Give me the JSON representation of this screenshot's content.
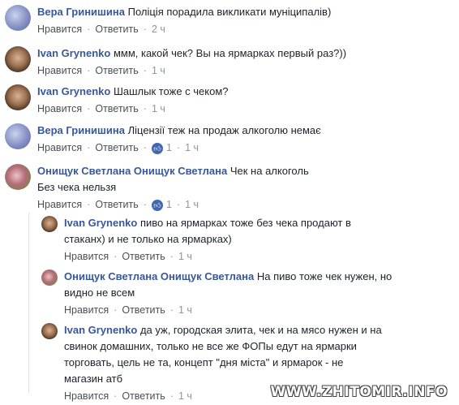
{
  "comments": [
    {
      "author": "Вера Гринишина",
      "text": "Поліція порадила викликати муніципалів)",
      "like_label": "Нравится",
      "reply_label": "Ответить",
      "time": "2 ч",
      "likes": ""
    },
    {
      "author": "Ivan Grynenko",
      "text": "ммм, какой чек? Вы на ярмарках первый раз?))",
      "like_label": "Нравится",
      "reply_label": "Ответить",
      "time": "1 ч",
      "likes": ""
    },
    {
      "author": "Ivan Grynenko",
      "text": "Шашлык тоже с чеком?",
      "like_label": "Нравится",
      "reply_label": "Ответить",
      "time": "1 ч",
      "likes": ""
    },
    {
      "author": "Вера Гринишина",
      "text": "Ліцензії теж на продаж алкоголю немає",
      "like_label": "Нравится",
      "reply_label": "Ответить",
      "time": "1 ч",
      "likes": "1"
    },
    {
      "author": "Онищук Светлана Онищук Светлана",
      "text": "Чек на алкоголь",
      "text2": "Без чека нельзя",
      "like_label": "Нравится",
      "reply_label": "Ответить",
      "time": "1 ч",
      "likes": "1"
    }
  ],
  "replies": [
    {
      "author": "Ivan Grynenko",
      "text_line1": "пиво на ярмарках тоже без чека продают в",
      "text_line2": "стаканх) и не только на ярмарках)",
      "like_label": "Нравится",
      "reply_label": "Ответить",
      "time": "1 ч"
    },
    {
      "author": "Онищук Светлана Онищук Светлана",
      "text_line1": "На пиво тоже чек нужен, но",
      "text_line2": "видно не всем",
      "like_label": "Нравится",
      "reply_label": "Ответить",
      "time": "1 ч"
    },
    {
      "author": "Ivan Grynenko",
      "text_line1": "да уж, городская элита, чек и на мясо нужен и на",
      "text_line2": "свинок домашних, только не все же ФОПы едут на ярмарки",
      "text_line3": "торговать, цель не та, концепт \"дня міста\" и ярмарок - не",
      "text_line4": "магазин атб",
      "like_label": "Нравится",
      "reply_label": "Ответить",
      "time": "1 ч"
    }
  ],
  "separator": "·",
  "watermark": "WWW.ZHITOMIR.INFO",
  "colors": {
    "author": "#385898",
    "meta": "#90949c",
    "like_badge": "#4267b2"
  }
}
